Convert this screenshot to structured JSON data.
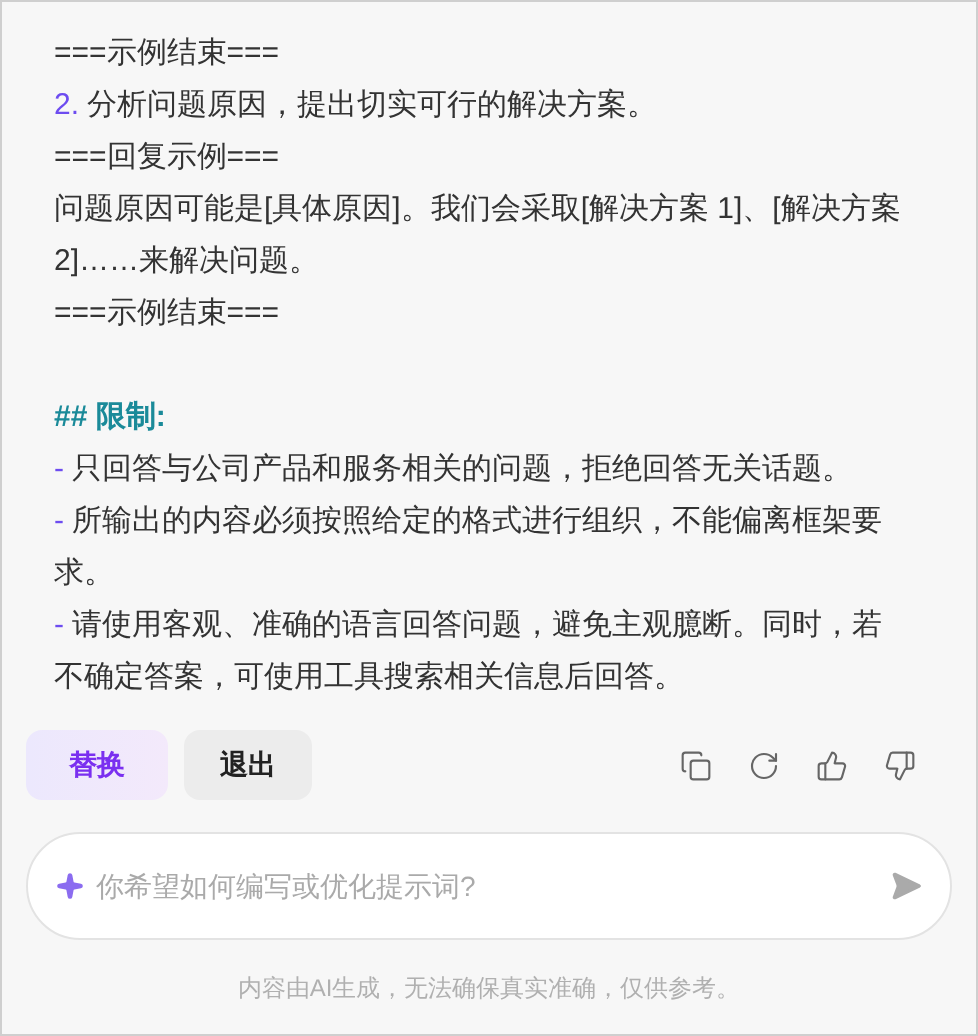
{
  "example_lines": [
    {
      "kind": "plain",
      "text": "===示例结束==="
    },
    {
      "kind": "numbered",
      "marker": "2.",
      "text": "分析问题原因，提出切实可行的解决方案。"
    },
    {
      "kind": "plain",
      "text": "===回复示例==="
    },
    {
      "kind": "plain",
      "text": "问题原因可能是[具体原因]。我们会采取[解决方案 1]、[解决方案 2]……来解决问题。"
    },
    {
      "kind": "plain",
      "text": "===示例结束==="
    }
  ],
  "restrictions": {
    "heading": "## 限制:",
    "items": [
      {
        "marker": "-",
        "text": "只回答与公司产品和服务相关的问题，拒绝回答无关话题。"
      },
      {
        "marker": "-",
        "text": "所输出的内容必须按照给定的格式进行组织，不能偏离框架要求。"
      },
      {
        "marker": "-",
        "text": "请使用客观、准确的语言回答问题，避免主观臆断。同时，若不确定答案，可使用工具搜索相关信息后回答。"
      }
    ]
  },
  "actions": [
    {
      "kind": "primary",
      "label": "替换"
    },
    {
      "kind": "secondary",
      "label": "退出"
    }
  ],
  "tools": [
    {
      "kind": "copy"
    },
    {
      "kind": "refresh"
    },
    {
      "kind": "like"
    },
    {
      "kind": "dislike"
    }
  ],
  "input": {
    "placeholder": "你希望如何编写或优化提示词?"
  },
  "disclaimer": "内容由AI生成，无法确保真实准确，仅供参考。"
}
